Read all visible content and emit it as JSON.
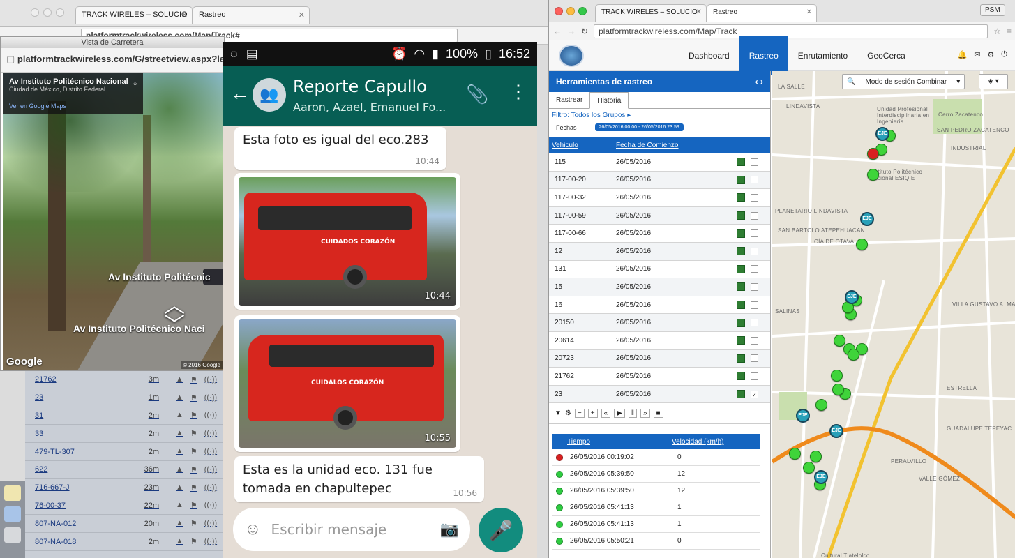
{
  "bg_window": {
    "tabs": [
      "TRACK WIRELES – SOLUCIO",
      "Rastreo"
    ],
    "url": "platformtrackwireless.com/Map/Track#",
    "list_rows": [
      {
        "unit": "21762",
        "dist": "3m"
      },
      {
        "unit": "23",
        "dist": "1m"
      },
      {
        "unit": "31",
        "dist": "2m"
      },
      {
        "unit": "33",
        "dist": "2m"
      },
      {
        "unit": "479-TL-307",
        "dist": "2m"
      },
      {
        "unit": "622",
        "dist": "36m"
      },
      {
        "unit": "716-667-J",
        "dist": "23m"
      },
      {
        "unit": "76-00-37",
        "dist": "22m"
      },
      {
        "unit": "807-NA-012",
        "dist": "20m"
      },
      {
        "unit": "807-NA-018",
        "dist": "2m"
      }
    ]
  },
  "streetview": {
    "window_title": "Vista de Carretera",
    "url": "platformtrackwireless.com/G/streetview.aspx?lat=",
    "card_title": "Av Instituto Politécnico Nacional",
    "card_sub": "Ciudad de México, Distrito Federal",
    "card_link": "Ver en Google Maps",
    "road_label_1": "Av Instituto Politécnic",
    "road_label_2": "Av Instituto Politécnico Naci",
    "google": "Google",
    "copyright": "© 2016 Google"
  },
  "whatsapp": {
    "status": {
      "battery": "100%",
      "time": "16:52"
    },
    "chat_title": "Reporte Capullo",
    "chat_members": "Aaron, Azael, Emanuel Fo...",
    "messages": [
      {
        "text": "Esta foto es igual del eco.283",
        "time": "10:44"
      },
      {
        "photo_time": "10:44"
      },
      {
        "photo_time": "10:55"
      },
      {
        "text": "Esta es la unidad  eco. 131 fue tomada en chapultepec",
        "time": "10:56"
      }
    ],
    "input_placeholder": "Escribir mensaje",
    "bus_ad_1": "CUIDADOS CORAZÓN",
    "bus_ad_2": "CUIDALOS CORAZÓN"
  },
  "tracker": {
    "tabs": [
      "TRACK WIRELES – SOLUCIO",
      "Rastreo"
    ],
    "profile": "PSM",
    "url": "platformtrackwireless.com/Map/Track",
    "nav": [
      "Dashboard",
      "Rastreo",
      "Enrutamiento",
      "GeoCerca"
    ],
    "panel_title": "Herramientas de rastreo",
    "subtabs": [
      "Rastrear",
      "Historia"
    ],
    "filter": "Filtro: Todos los Grupos ▸",
    "fechas_label": "Fechas",
    "fechas_value": "26/05/2016 00:00 - 26/05/2016 23:59",
    "vehicle_header": "Vehiculo",
    "date_header": "Fecha de Comienzo",
    "vehicles": [
      {
        "id": "115",
        "date": "26/05/2016"
      },
      {
        "id": "117-00-20",
        "date": "26/05/2016"
      },
      {
        "id": "117-00-32",
        "date": "26/05/2016"
      },
      {
        "id": "117-00-59",
        "date": "26/05/2016"
      },
      {
        "id": "117-00-66",
        "date": "26/05/2016"
      },
      {
        "id": "12",
        "date": "26/05/2016"
      },
      {
        "id": "131",
        "date": "26/05/2016"
      },
      {
        "id": "15",
        "date": "26/05/2016"
      },
      {
        "id": "16",
        "date": "26/05/2016"
      },
      {
        "id": "20150",
        "date": "26/05/2016"
      },
      {
        "id": "20614",
        "date": "26/05/2016"
      },
      {
        "id": "20723",
        "date": "26/05/2016"
      },
      {
        "id": "21762",
        "date": "26/05/2016"
      },
      {
        "id": "23",
        "date": "26/05/2016"
      }
    ],
    "time_header": "Tiempo",
    "speed_header": "Velocidad (km/h)",
    "history": [
      {
        "time": "26/05/2016 00:19:02",
        "speed": "0"
      },
      {
        "time": "26/05/2016 05:39:50",
        "speed": "12"
      },
      {
        "time": "26/05/2016 05:39:50",
        "speed": "12"
      },
      {
        "time": "26/05/2016 05:41:13",
        "speed": "1"
      },
      {
        "time": "26/05/2016 05:41:13",
        "speed": "1"
      },
      {
        "time": "26/05/2016 05:50:21",
        "speed": "0"
      }
    ],
    "map_mode": "Modo de sesión Combinar",
    "map_labels": [
      "LA SALLE",
      "LINDAVISTA",
      "Unidad Profesional Interdisciplinaria en Ingeniería",
      "Cerro Zacatenco",
      "SAN PEDRO ZACATENCO",
      "INDUSTRIAL",
      "Instituto Politécnico Nacional ESIQIE",
      "PLANETARIO LINDAVISTA",
      "SAN BARTOLO ATEPEHUACAN",
      "SALINAS",
      "VILLA GUSTAVO A. MADERO",
      "ESTRELLA",
      "GUADALUPE TEPEYAC",
      "PERALVILLO",
      "VALLE GÓMEZ",
      "CÍA DE OTAVALO",
      "Cultural Tlatelolco"
    ]
  }
}
